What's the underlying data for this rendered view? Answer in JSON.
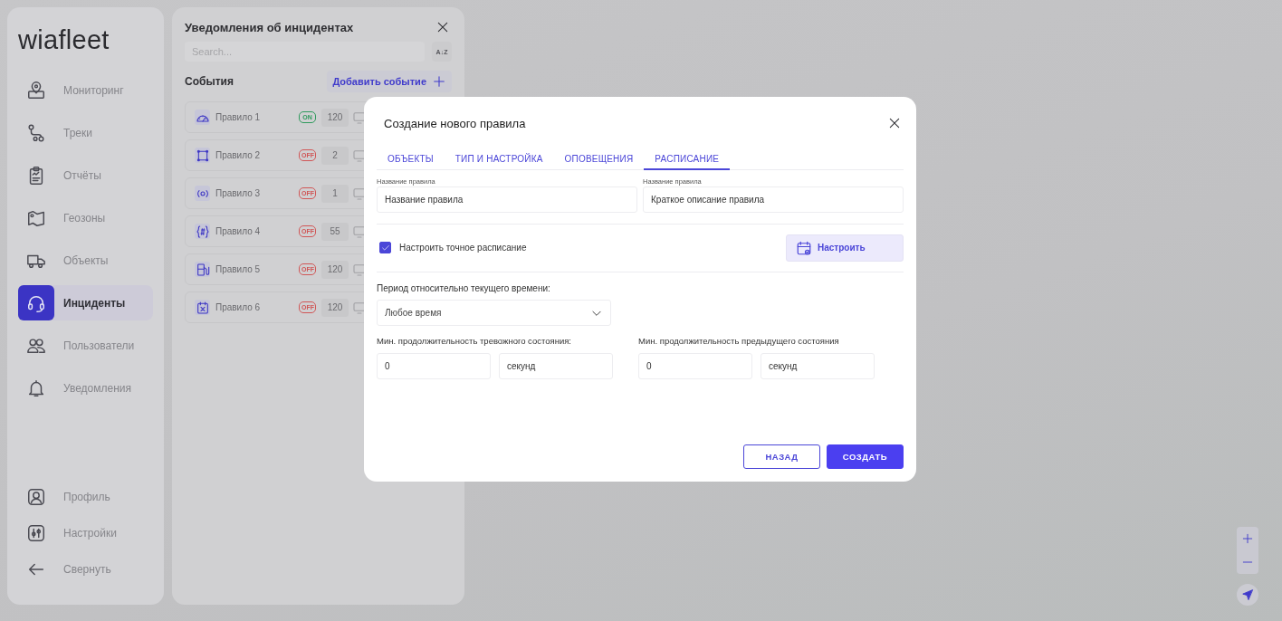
{
  "sidebar": {
    "logo": "wiafleet",
    "nav_items": [
      {
        "label": "Мониторинг",
        "selected": false
      },
      {
        "label": "Треки",
        "selected": false
      },
      {
        "label": "Отчёты",
        "selected": false
      },
      {
        "label": "Геозоны",
        "selected": false
      },
      {
        "label": "Объекты",
        "selected": false
      },
      {
        "label": "Инциденты",
        "selected": true
      },
      {
        "label": "Пользователи",
        "selected": false
      },
      {
        "label": "Уведомления",
        "selected": false
      }
    ],
    "footer_items": [
      {
        "label": "Профиль"
      },
      {
        "label": "Настройки"
      },
      {
        "label": "Свернуть"
      }
    ]
  },
  "panel": {
    "title": "Уведомления об инцидентах",
    "search": {
      "placeholder": "Search..."
    },
    "sort_button": "A↓Z",
    "section_title": "События",
    "add_button": "Добавить событие",
    "rules": [
      {
        "name": "Правило 1",
        "on": true,
        "badge": "ON",
        "count": "120"
      },
      {
        "name": "Правило 2",
        "on": false,
        "badge": "OFF",
        "count": "2"
      },
      {
        "name": "Правило 3",
        "on": false,
        "badge": "OFF",
        "count": "1"
      },
      {
        "name": "Правило 4",
        "on": false,
        "badge": "OFF",
        "count": "55"
      },
      {
        "name": "Правило 5",
        "on": false,
        "badge": "OFF",
        "count": "120"
      },
      {
        "name": "Правило 6",
        "on": false,
        "badge": "OFF",
        "count": "120"
      }
    ]
  },
  "dialog": {
    "title": "Создание нового правила",
    "tabs": [
      {
        "label": "ОБЪЕКТЫ",
        "selected": false
      },
      {
        "label": "ТИП И НАСТРОЙКА",
        "selected": false
      },
      {
        "label": "ОПОВЕЩЕНИЯ",
        "selected": false
      },
      {
        "label": "РАСПИСАНИЕ",
        "selected": true
      }
    ],
    "name_fields": [
      {
        "label": "Название правила",
        "value": "Название правила"
      },
      {
        "label": "Название правила",
        "value": "Краткое описание правила"
      }
    ],
    "exact_schedule": {
      "label": "Настроить точное расписание",
      "checked": true
    },
    "configure_button": "Настроить",
    "period": {
      "label": "Период относительно текущего времени:",
      "value": "Любое время"
    },
    "durations": [
      {
        "label": "Мин. продолжительность тревожного состояния:",
        "value": "0",
        "unit": "секунд"
      },
      {
        "label": "Мин. продолжительность предыдущего состояния",
        "value": "0",
        "unit": "секунд"
      }
    ],
    "buttons": [
      {
        "label": "НАЗАД",
        "kind": "secondary"
      },
      {
        "label": "СОЗДАТЬ",
        "kind": "primary"
      }
    ]
  }
}
